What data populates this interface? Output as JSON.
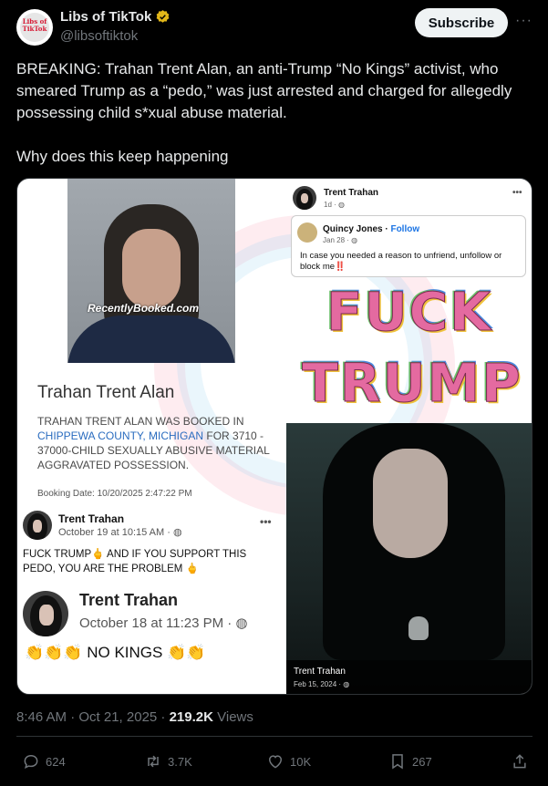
{
  "account": {
    "name": "Libs of TikTok",
    "handle": "@libsoftiktok",
    "avatar_text": "Libs of TikTok"
  },
  "header": {
    "subscribe_label": "Subscribe",
    "more_label": "···"
  },
  "tweet": {
    "paragraph1": "BREAKING: Trahan Trent Alan, an anti-Trump “No Kings” activist, who smeared Trump as a “pedo,” was just arrested and charged for allegedly possessing child s*xual abuse material.",
    "paragraph2": "Why does this keep happening"
  },
  "media": {
    "mugshot_watermark": "RecentlyBooked.com",
    "booking_name": "Trahan Trent Alan",
    "booking_desc_pre": "TRAHAN TRENT ALAN WAS BOOKED IN ",
    "booking_location": "CHIPPEWA COUNTY, MICHIGAN",
    "booking_desc_post": " FOR 3710 - 37000-CHILD SEXUALLY ABUSIVE MATERIAL AGGRAVATED POSSESSION.",
    "booking_date": "Booking Date: 10/20/2025 2:47:22 PM",
    "post1": {
      "name": "Trent Trahan",
      "date": "October 19 at 10:15 AM · ◍",
      "text": "FUCK TRUMP🖕 AND IF YOU SUPPORT THIS PEDO, YOU ARE THE PROBLEM 🖕",
      "dots": "•••"
    },
    "post2": {
      "name": "Trent Trahan",
      "date": "October 18 at 11:23 PM · ◍",
      "text": "👏👏👏 NO KINGS 👏👏"
    },
    "fb_top": {
      "name": "Trent Trahan",
      "date": "1d · ◍",
      "dots": "•••"
    },
    "quote": {
      "name": "Quincy Jones",
      "follow": "Follow",
      "date": "Jan 28 · ◍",
      "text": "In case you needed a reason to unfriend, unfollow or block me",
      "exclaim": "‼️"
    },
    "flower_line1": "FUCK",
    "flower_line2": "TRUMP",
    "photo2": {
      "name": "Trent Trahan",
      "date": "Feb 15, 2024 · ◍"
    }
  },
  "meta": {
    "time": "8:46 AM · Oct 21, 2025 · ",
    "views_count": "219.2K",
    "views_label": " Views"
  },
  "actions": {
    "replies": "624",
    "reposts": "3.7K",
    "likes": "10K",
    "bookmarks": "267"
  },
  "colors": {
    "background": "#000000",
    "text": "#e7e9ea",
    "muted": "#71767b",
    "verified_gold": "#e2b719",
    "subscribe_bg": "#eff3f4"
  }
}
